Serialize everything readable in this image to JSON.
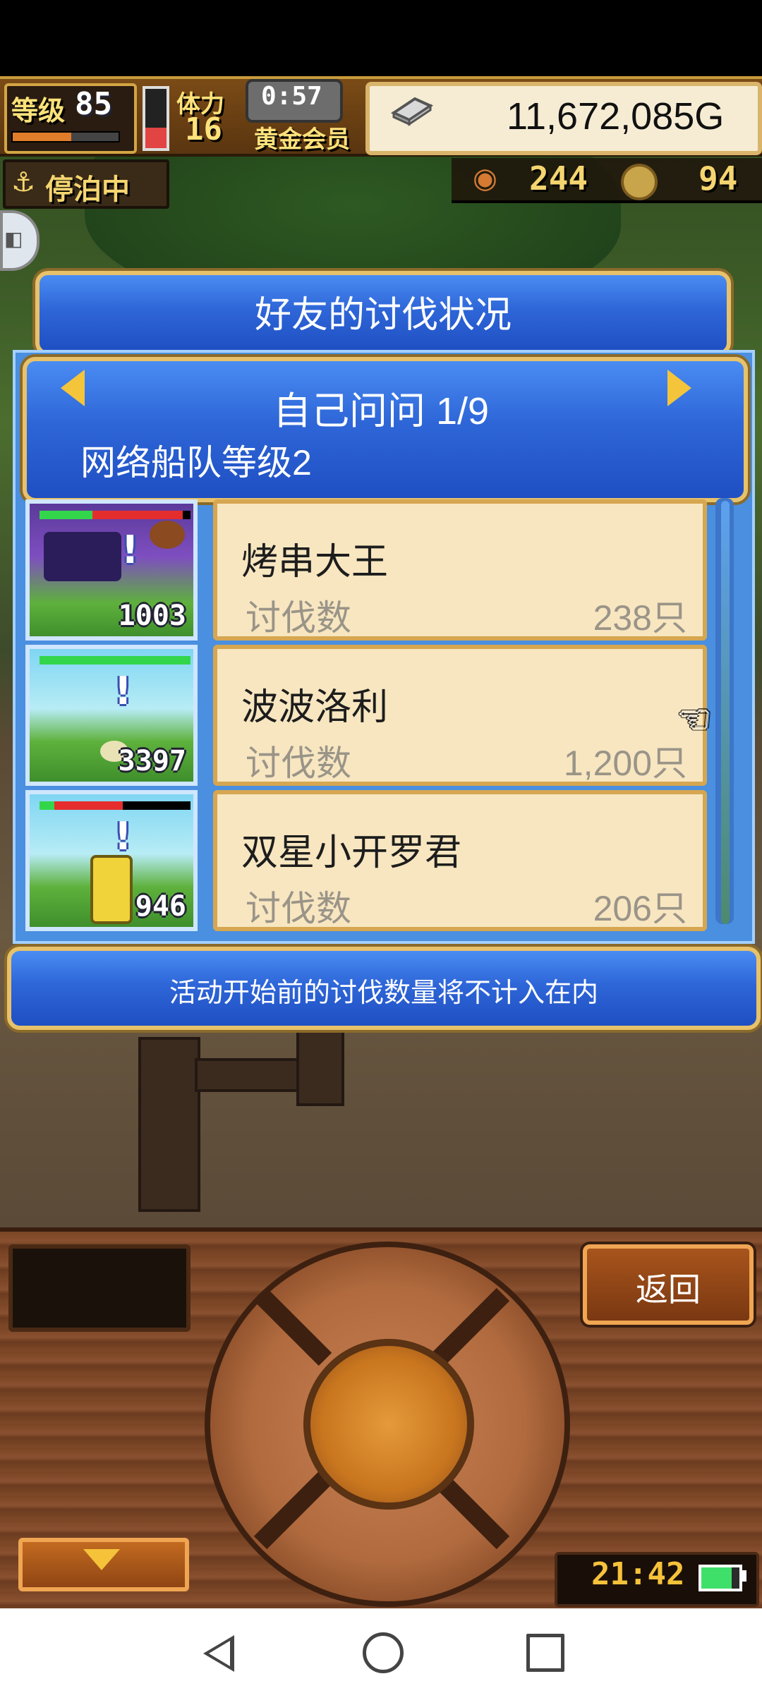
{
  "hud": {
    "level_label": "等级",
    "level_value": "85",
    "exp_fraction": 0.55,
    "stamina_label": "体力",
    "stamina_value": "16",
    "stamina_fraction": 0.35,
    "timer": "0:57",
    "membership": "黄金会员",
    "gold": "11,672,085G",
    "status_label": "停泊中",
    "food_value": "244",
    "coin_value": "94"
  },
  "dialog": {
    "title": "好友的讨伐状况",
    "friend_name": "自己问问 1/9",
    "fleet_level": "网络船队等级2",
    "entries": [
      {
        "monster_number": "1003",
        "name": "烤串大王",
        "label": "讨伐数",
        "count": "238只",
        "hp_green": 0.35,
        "hp_red": 0.6
      },
      {
        "monster_number": "3397",
        "name": "波波洛利",
        "label": "讨伐数",
        "count": "1,200只",
        "hp_green": 1.0,
        "hp_red": 0.0
      },
      {
        "monster_number": "946",
        "name": "双星小开罗君",
        "label": "讨伐数",
        "count": "206只",
        "hp_green": 0.1,
        "hp_red": 0.45
      }
    ],
    "notice": "活动开始前的讨伐数量将不计入在内"
  },
  "controls": {
    "back_label": "返回",
    "clock": "21:42",
    "battery_fraction": 0.8
  },
  "icons": {
    "anchor": "⚓",
    "food": "◉",
    "pointer": "☜",
    "side": "◧"
  },
  "colors": {
    "panel_blue": "#2e66d8",
    "gold_border": "#e8c26a",
    "card_bg": "#f7e6c0",
    "card_text": "#9a9488"
  }
}
